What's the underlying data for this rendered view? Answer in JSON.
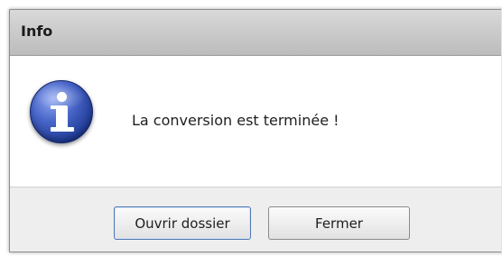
{
  "dialog": {
    "title": "Info",
    "message": "La conversion est terminée !",
    "icon": "info-icon",
    "buttons": {
      "open_folder": "Ouvrir dossier",
      "close": "Fermer"
    }
  },
  "colors": {
    "titlebar": "#c9c9c9",
    "dialog_background": "#ececec",
    "content_background": "#ffffff",
    "icon_blue": "#2b4aa8",
    "focus_border": "#4f78b3"
  }
}
